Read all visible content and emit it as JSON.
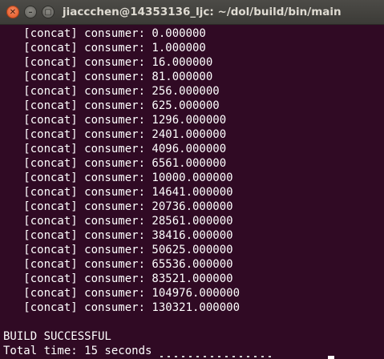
{
  "window": {
    "title": "jiaccchen@14353136_ljc: ~/dol/build/bin/main",
    "close_glyph": "✕",
    "minimize_glyph": "–",
    "maximize_glyph": "▢"
  },
  "terminal": {
    "lines": [
      "   [concat] consumer: 0.000000",
      "   [concat] consumer: 1.000000",
      "   [concat] consumer: 16.000000",
      "   [concat] consumer: 81.000000",
      "   [concat] consumer: 256.000000",
      "   [concat] consumer: 625.000000",
      "   [concat] consumer: 1296.000000",
      "   [concat] consumer: 2401.000000",
      "   [concat] consumer: 4096.000000",
      "   [concat] consumer: 6561.000000",
      "   [concat] consumer: 10000.000000",
      "   [concat] consumer: 14641.000000",
      "   [concat] consumer: 20736.000000",
      "   [concat] consumer: 28561.000000",
      "   [concat] consumer: 38416.000000",
      "   [concat] consumer: 50625.000000",
      "   [concat] consumer: 65536.000000",
      "   [concat] consumer: 83521.000000",
      "   [concat] consumer: 104976.000000",
      "   [concat] consumer: 130321.000000",
      "",
      "BUILD SUCCESSFUL",
      "Total time: 15 seconds"
    ]
  },
  "colors": {
    "background": "#300a24",
    "text": "#ffffff",
    "titlebar": "#3c3b37",
    "close_button": "#e2511f"
  }
}
